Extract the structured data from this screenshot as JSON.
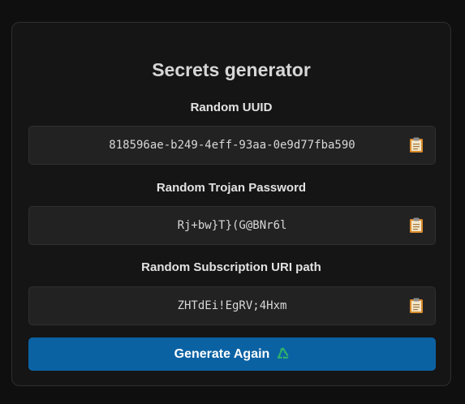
{
  "card": {
    "title": "Secrets generator"
  },
  "fields": [
    {
      "label": "Random UUID",
      "value": "818596ae-b249-4eff-93aa-0e9d77fba590",
      "icon": "clipboard-icon"
    },
    {
      "label": "Random Trojan Password",
      "value": "Rj+bw}T}(G@BNr6l",
      "icon": "clipboard-icon"
    },
    {
      "label": "Random Subscription URI path",
      "value": "ZHTdEi!EgRV;4Hxm",
      "icon": "clipboard-icon"
    }
  ],
  "button": {
    "label": "Generate Again",
    "icon": "recycle-icon"
  },
  "colors": {
    "background": "#0f0f0f",
    "card": "#151515",
    "field": "#222222",
    "button": "#0b62a3",
    "recycle": "#2fb36b",
    "clipboard": "#d98a2b"
  }
}
